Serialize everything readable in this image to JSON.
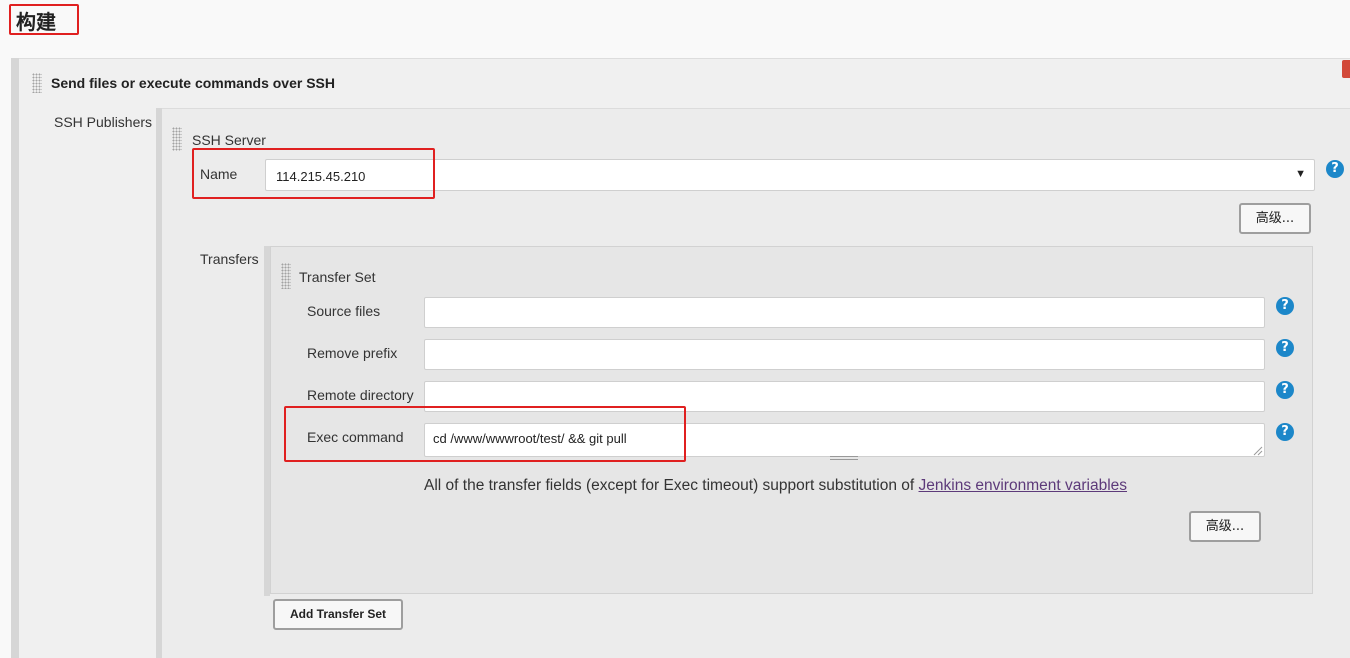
{
  "section": {
    "heading": "构建"
  },
  "publisher": {
    "title": "Send files or execute commands over SSH"
  },
  "ssh_publishers": {
    "label": "SSH Publishers",
    "server_title": "SSH Server",
    "name_label": "Name",
    "name_value": "114.215.45.210",
    "advanced_label": "高级..."
  },
  "transfers": {
    "label": "Transfers",
    "set_title": "Transfer Set",
    "fields": [
      {
        "label": "Source files",
        "value": ""
      },
      {
        "label": "Remove prefix",
        "value": ""
      },
      {
        "label": "Remote directory",
        "value": ""
      },
      {
        "label": "Exec command",
        "value": "cd /www/wwwroot/test/ && git pull"
      }
    ],
    "info_text": "All of the transfer fields (except for Exec timeout) support substitution of ",
    "info_link": "Jenkins environment variables",
    "advanced_label": "高级...",
    "add_button_label": "Add Transfer Set"
  },
  "icons": {
    "help": "help-icon",
    "drag": "drag-handle-icon",
    "dropdown": "chevron-down-icon"
  },
  "colors": {
    "highlight": "#e02020",
    "help": "#1c87c9",
    "link": "#5d3a7a"
  },
  "help_glyph": "?",
  "dropdown_glyph": "▼"
}
